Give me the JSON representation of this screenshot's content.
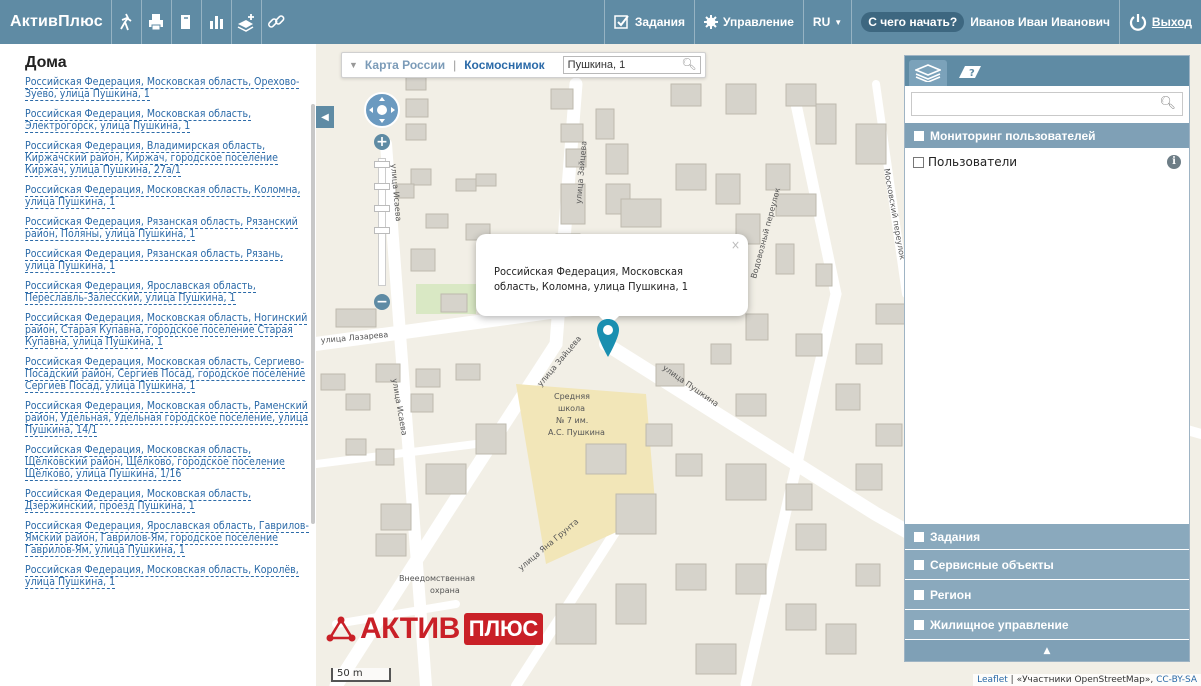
{
  "app": {
    "brand": "АктивПлюс"
  },
  "topbar": {
    "tasks": "Задания",
    "manage": "Управление",
    "lang": "RU",
    "help": "С чего начать?",
    "user": "Иванов Иван Иванович",
    "logout": "Выход"
  },
  "sidebar": {
    "title": "Дома",
    "items": [
      "Российская Федерация, Московская область, Орехово-Зуево, улица Пушкина, 1",
      "Российская Федерация, Московская область, Электрогорск, улица Пушкина, 1",
      "Российская Федерация, Владимирская область, Киржачский район, Киржач, городское поселение Киржач, улица Пушкина, 27а/1",
      "Российская Федерация, Московская область, Коломна, улица Пушкина, 1",
      "Российская Федерация, Рязанская область, Рязанский район, Поляны, улица Пушкина, 1",
      "Российская Федерация, Рязанская область, Рязань, улица Пушкина, 1",
      "Российская Федерация, Ярославская область, Переславль-Залесский, улица Пушкина, 1",
      "Российская Федерация, Московская область, Ногинский район, Старая Купавна, городское поселение Старая Купавна, улица Пушкина, 1",
      "Российская Федерация, Московская область, Сергиево-Посадский район, Сергиев Посад, городское поселение Сергиев Посад, улица Пушкина, 1",
      "Российская Федерация, Московская область, Раменский район, Удельная, Удельная городское поселение, улица Пушкина, 14/1",
      "Российская Федерация, Московская область, Щёлковский район, Щёлково, городское поселение Щёлково, улица Пушкина, 1/16",
      "Российская Федерация, Московская область, Дзержинский, проезд Пушкина, 1",
      "Российская Федерация, Ярославская область, Гаврилов-Ямский район, Гаврилов-Ям, городское поселение Гаврилов-Ям, улица Пушкина, 1",
      "Российская Федерация, Московская область, Королёв, улица Пушкина, 1"
    ]
  },
  "map": {
    "layer_map": "Карта России",
    "layer_sat": "Космоснимок",
    "search_value": "Пушкина, 1",
    "popup_text": "Российская Федерация, Московская область, Коломна, улица Пушкина, 1",
    "popup_close": "×",
    "scale": "50 m",
    "attribution_leaflet": "Leaflet",
    "attribution_osm": "| «Участники OpenStreetMap»,",
    "attribution_cc": "CC-BY-SA",
    "logo_text": "АКТИВ",
    "logo_plus": "ПЛЮС",
    "streets": [
      "улица Лазарева",
      "улица Исаева",
      "улица Зайцева",
      "улица Пушкина",
      "Водовозный переулок",
      "Московский переулок",
      "улица Яна Грунта",
      "Внеедомственная охрана"
    ],
    "school_label": "Средняя школа № 7 им. А.С. Пушкина"
  },
  "right_panel": {
    "monitoring": "Мониторинг пользователей",
    "users": "Пользователи",
    "sections": [
      "Задания",
      "Сервисные объекты",
      "Регион",
      "Жилищное управление"
    ]
  },
  "colors": {
    "topbar": "#5f8ba4",
    "link": "#2b6aa8",
    "section": "#8aa9bd",
    "logo_red": "#c92027"
  }
}
